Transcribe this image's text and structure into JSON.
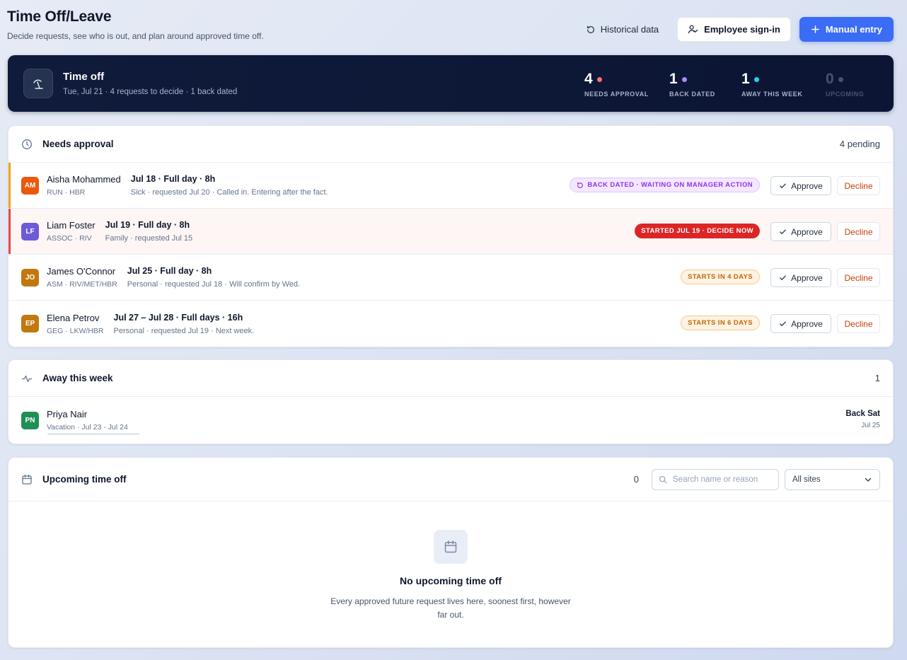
{
  "header": {
    "title": "Time Off/Leave",
    "subtitle": "Decide requests, see who is out, and plan around approved time off.",
    "historical_label": "Historical data",
    "signin_label": "Employee sign-in",
    "manual_label": "Manual entry"
  },
  "hero": {
    "title": "Time off",
    "subtitle": "Tue, Jul 21 · 4 requests to decide · 1 back dated",
    "stats": [
      {
        "value": "4",
        "label": "NEEDS APPROVAL",
        "dot_color": "#f87171"
      },
      {
        "value": "1",
        "label": "BACK DATED",
        "dot_color": "#a78bfa"
      },
      {
        "value": "1",
        "label": "AWAY THIS WEEK",
        "dot_color": "#22d3ee"
      },
      {
        "value": "0",
        "label": "UPCOMING",
        "dot_color": "#475272"
      }
    ]
  },
  "needs_approval": {
    "title": "Needs approval",
    "count": "4 pending",
    "approve_label": "Approve",
    "decline_label": "Decline",
    "rows": [
      {
        "initials": "AM",
        "name": "Aisha Mohammed",
        "meta": "RUN · HBR",
        "when": "Jul 18 · Full day · 8h",
        "detail": "Sick · requested Jul 20  · Called in. Entering after the fact.",
        "badge": "BACK DATED · WAITING ON MANAGER ACTION",
        "avatar_color": "#ea580c",
        "accent_color": "#f59e0b"
      },
      {
        "initials": "LF",
        "name": "Liam Foster",
        "meta": "ASSOC · RIV",
        "when": "Jul 19 · Full day · 8h",
        "detail": "Family · requested Jul 15",
        "badge": "STARTED JUL 19 · DECIDE NOW",
        "avatar_color": "#6d5ad6",
        "accent_color": "#ef4444"
      },
      {
        "initials": "JO",
        "name": "James O'Connor",
        "meta": "ASM · RIV/MET/HBR",
        "when": "Jul 25 · Full day · 8h",
        "detail": "Personal · requested Jul 18  · Will confirm by Wed.",
        "badge": "STARTS IN 4 DAYS",
        "avatar_color": "#c2770f",
        "accent_color": ""
      },
      {
        "initials": "EP",
        "name": "Elena Petrov",
        "meta": "GEG · LKW/HBR",
        "when": "Jul 27 – Jul 28 · Full days · 16h",
        "detail": "Personal · requested Jul 19  · Next week.",
        "badge": "STARTS IN 6 DAYS",
        "avatar_color": "#c2770f",
        "accent_color": ""
      }
    ]
  },
  "away": {
    "title": "Away this week",
    "count": "1",
    "rows": [
      {
        "initials": "PN",
        "name": "Priya Nair",
        "meta": "Vacation · Jul 23 - Jul 24",
        "back": "Back Sat",
        "date": "Jul 25",
        "avatar_color": "#1f8f55",
        "progress": 0.0
      }
    ]
  },
  "upcoming": {
    "title": "Upcoming time off",
    "count": "0",
    "search_placeholder": "Search name or reason",
    "site_select": "All sites",
    "empty_title": "No upcoming time off",
    "empty_text": "Every approved future request lives here, soonest first, however far out."
  }
}
